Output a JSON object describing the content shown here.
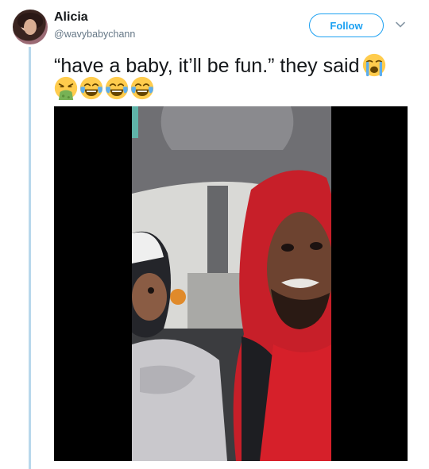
{
  "tweet": {
    "author": {
      "name": "Alicia",
      "handle": "@wavybabychann",
      "avatar_icon": "profile-photo"
    },
    "follow_label": "Follow",
    "menu_icon": "chevron-down-icon",
    "text": "“have a baby, it’ll be fun.” they said",
    "emojis": [
      "loudly-crying-face",
      "face-vomiting",
      "face-with-tears-of-joy",
      "face-with-tears-of-joy",
      "face-with-tears-of-joy"
    ],
    "media": {
      "type": "video",
      "description_icon": "video-frame"
    }
  },
  "colors": {
    "accent": "#1da1f2",
    "text": "#14171a",
    "secondary_text": "#657786",
    "thread_line": "#b8d8ec",
    "hoodie_red": "#d6202a"
  }
}
